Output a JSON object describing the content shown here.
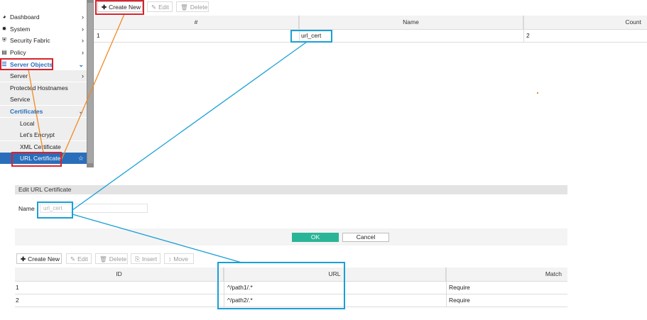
{
  "sidebar": {
    "items": [
      {
        "label": "Dashboard",
        "icon": "dashboard-icon",
        "glyph": "◕",
        "chevron": "›"
      },
      {
        "label": "System",
        "icon": "gear-icon",
        "glyph": "✹",
        "chevron": "›"
      },
      {
        "label": "Security Fabric",
        "icon": "shield-icon",
        "glyph": "⛨",
        "chevron": "›"
      },
      {
        "label": "Policy",
        "icon": "policy-icon",
        "glyph": "▤",
        "chevron": "›"
      },
      {
        "label": "Server Objects",
        "icon": "server-objects-icon",
        "glyph": "☰",
        "chevron": "⌄"
      }
    ],
    "sub_items": [
      {
        "label": "Server",
        "chevron": "›"
      },
      {
        "label": "Protected Hostnames"
      },
      {
        "label": "Service"
      },
      {
        "label": "Certificates",
        "chevron": "⌄"
      }
    ],
    "cert_items": [
      {
        "label": "Local"
      },
      {
        "label": "Let's Encrypt"
      },
      {
        "label": "XML Certificate"
      },
      {
        "label": "URL Certificate",
        "star": "☆"
      }
    ]
  },
  "toolbar_top": {
    "create_new": "Create New",
    "create_glyph": "✚",
    "edit": "Edit",
    "edit_glyph": "✎",
    "delete": "Delete",
    "delete_glyph": "🗑"
  },
  "top_table": {
    "headers": [
      "#",
      "Name",
      "Count"
    ],
    "rows": [
      {
        "num": "1",
        "name": "url_cert",
        "count": "2"
      }
    ]
  },
  "edit_form": {
    "title": "Edit URL Certificate",
    "name_label": "Name",
    "name_value": "url_cert",
    "ok": "OK",
    "cancel": "Cancel"
  },
  "toolbar_bottom": {
    "create_new": "Create New",
    "create_glyph": "✚",
    "edit": "Edit",
    "edit_glyph": "✎",
    "delete": "Delete",
    "delete_glyph": "🗑",
    "insert": "Insert",
    "insert_glyph": "⎘",
    "move": "Move",
    "move_glyph": "↕"
  },
  "bottom_table": {
    "headers": [
      "ID",
      "URL",
      "Match"
    ],
    "rows": [
      {
        "id": "1",
        "url": "^/path1/.*",
        "match": "Require"
      },
      {
        "id": "2",
        "url": "^/path2/.*",
        "match": "Require"
      }
    ]
  },
  "colors": {
    "accent_blue": "#2a6ebb",
    "ok_green": "#2bb598",
    "annotation_red": "#d9232d",
    "annotation_blue": "#1a9fd6",
    "annotation_orange": "#f08a24"
  }
}
